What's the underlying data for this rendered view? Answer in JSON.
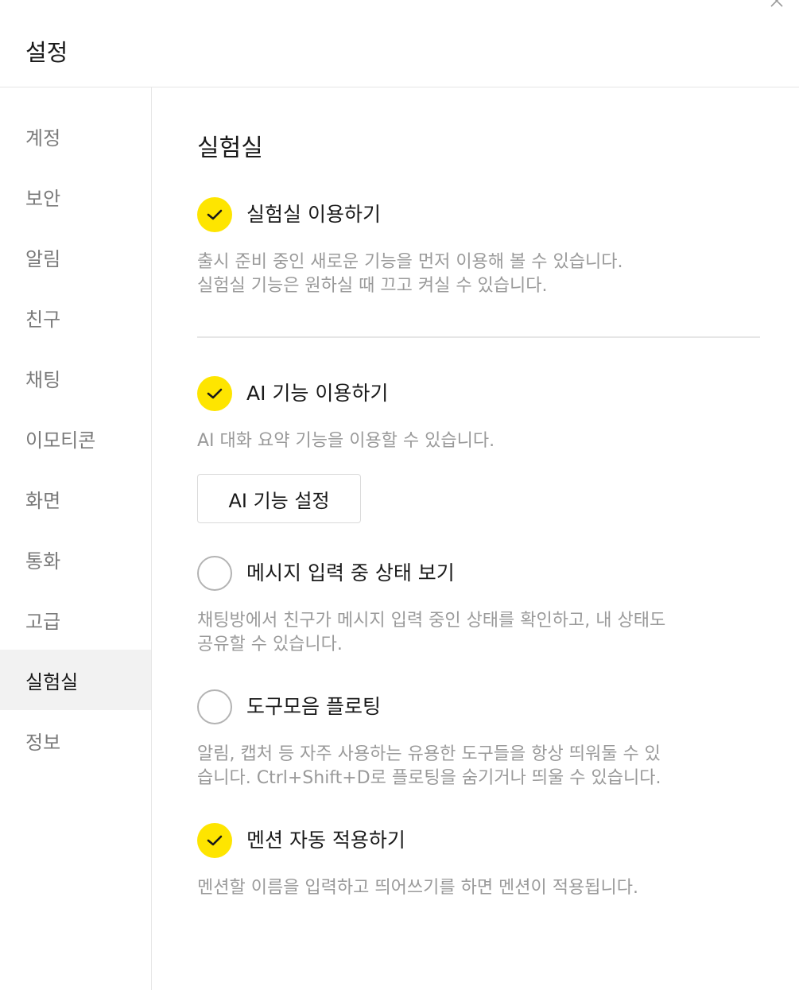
{
  "window": {
    "title": "설정",
    "close_label": "✕"
  },
  "sidebar": {
    "items": [
      {
        "label": "계정",
        "active": false
      },
      {
        "label": "보안",
        "active": false
      },
      {
        "label": "알림",
        "active": false
      },
      {
        "label": "친구",
        "active": false
      },
      {
        "label": "채팅",
        "active": false
      },
      {
        "label": "이모티콘",
        "active": false
      },
      {
        "label": "화면",
        "active": false
      },
      {
        "label": "통화",
        "active": false
      },
      {
        "label": "고급",
        "active": false
      },
      {
        "label": "실험실",
        "active": true
      },
      {
        "label": "정보",
        "active": false
      }
    ]
  },
  "main": {
    "title": "실험실",
    "labs": {
      "label": "실험실 이용하기",
      "checked": true,
      "desc_line1": "출시 준비 중인 새로운 기능을 먼저 이용해 볼 수 있습니다.",
      "desc_line2": "실험실 기능은 원하실 때 끄고 켜실 수 있습니다."
    },
    "ai": {
      "label": "AI 기능 이용하기",
      "checked": true,
      "desc_line1": "AI 대화 요약 기능을 이용할 수 있습니다.",
      "button_label": "AI 기능 설정"
    },
    "typing": {
      "label": "메시지 입력 중 상태 보기",
      "checked": false,
      "desc_line1": "채팅방에서 친구가 메시지 입력 중인 상태를 확인하고, 내 상태도",
      "desc_line2": "공유할 수 있습니다."
    },
    "toolbar": {
      "label": "도구모음 플로팅",
      "checked": false,
      "desc_line1": "알림, 캡처 등 자주 사용하는 유용한 도구들을 항상 띄워둘 수 있",
      "desc_line2": "습니다. Ctrl+Shift+D로 플로팅을 숨기거나 띄울 수 있습니다."
    },
    "mention": {
      "label": "멘션 자동 적용하기",
      "checked": true,
      "desc_line1": "멘션할 이름을 입력하고 띄어쓰기를 하면 멘션이 적용됩니다."
    }
  },
  "colors": {
    "accent": "#fee500",
    "check_mark": "#1a1a1a",
    "desc_text": "#9a9a9a",
    "sidebar_active_bg": "#f2f2f2"
  },
  "icons": {
    "close": "close-icon",
    "checked": "checkmark-icon",
    "unchecked": "empty-circle-icon"
  }
}
